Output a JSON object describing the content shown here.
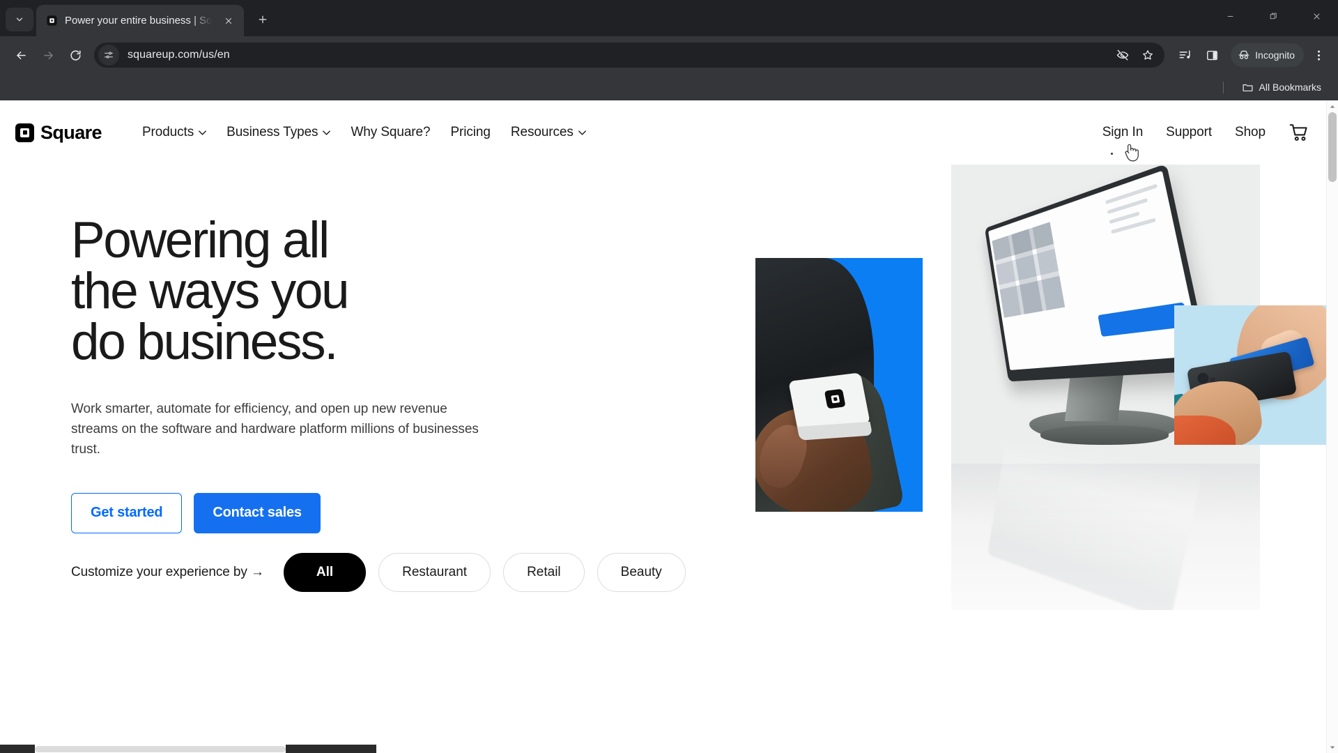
{
  "browser": {
    "tab": {
      "title": "Power your entire business | Sq",
      "favicon_icon": "square-favicon",
      "close_icon": "close-icon"
    },
    "tab_search_icon": "chevron-down-icon",
    "new_tab_icon": "plus-icon",
    "window_controls": {
      "minimize_icon": "minimize-icon",
      "restore_icon": "restore-icon",
      "close_icon": "window-close-icon"
    },
    "toolbar": {
      "back_icon": "back-arrow-icon",
      "forward_icon": "forward-arrow-icon",
      "reload_icon": "reload-icon",
      "site_info_icon": "tune-sliders-icon",
      "url": "squareup.com/us/en",
      "tracking_protection_icon": "eye-off-icon",
      "bookmark_icon": "star-icon",
      "media_icon": "media-playlist-icon",
      "side_panel_icon": "side-panel-icon",
      "incognito_icon": "incognito-hat-icon",
      "incognito_label": "Incognito",
      "menu_icon": "three-dot-menu-icon"
    },
    "bookmarks": {
      "folder_icon": "folder-icon",
      "all_bookmarks_label": "All Bookmarks"
    }
  },
  "site": {
    "logo": {
      "text": "Square",
      "icon": "square-logo-icon"
    },
    "nav": [
      {
        "label": "Products",
        "has_caret": true
      },
      {
        "label": "Business Types",
        "has_caret": true
      },
      {
        "label": "Why Square?",
        "has_caret": false
      },
      {
        "label": "Pricing",
        "has_caret": false
      },
      {
        "label": "Resources",
        "has_caret": true
      }
    ],
    "nav_right": [
      {
        "label": "Sign In"
      },
      {
        "label": "Support"
      },
      {
        "label": "Shop"
      }
    ],
    "cart_icon": "shopping-cart-icon",
    "hero": {
      "heading": "Powering all\nthe ways you\ndo business.",
      "paragraph": "Work smarter, automate for efficiency, and open up new revenue streams on the software and hardware platform millions of businesses trust.",
      "primary_cta": "Contact sales",
      "secondary_cta": "Get started",
      "images": [
        {
          "name": "square-reader-in-hand",
          "alt": "Hand holding a white Square card reader on a blue background"
        },
        {
          "name": "square-register-pos",
          "alt": "Square Register point of sale terminal on a light grey background"
        },
        {
          "name": "tap-to-pay-phone",
          "alt": "Blue card tapped against a phone on a light blue background"
        }
      ]
    },
    "customize": {
      "label": "Customize your experience by →",
      "pills": [
        {
          "label": "All",
          "active": true
        },
        {
          "label": "Restaurant",
          "active": false
        },
        {
          "label": "Retail",
          "active": false
        },
        {
          "label": "Beauty",
          "active": false
        }
      ]
    }
  },
  "colors": {
    "brand_blue": "#1570ef",
    "link_blue": "#006aff",
    "reader_bg_blue": "#0b7ef4",
    "tap_bg_blue": "#bfe2f2",
    "pos_bg_grey": "#eceded",
    "chrome_dark": "#202124",
    "chrome_toolbar": "#35363a",
    "text_dark": "#1a1a1a"
  }
}
